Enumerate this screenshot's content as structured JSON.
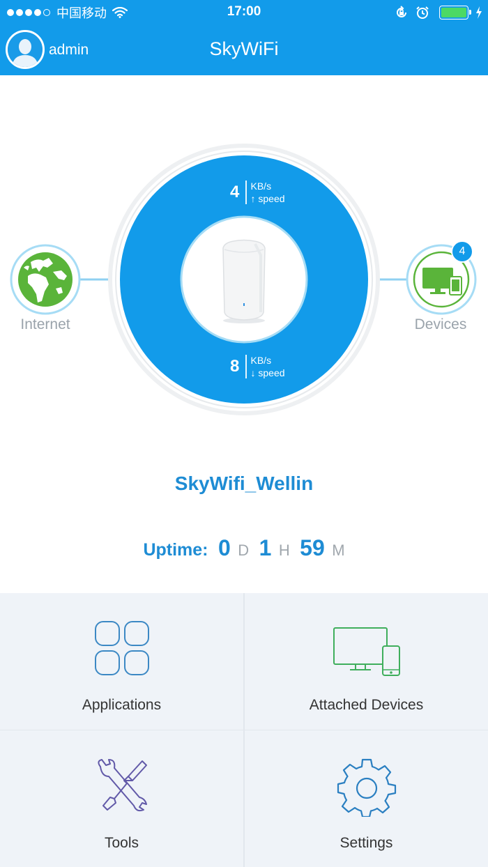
{
  "status_bar": {
    "carrier": "中国移动",
    "time": "17:00"
  },
  "header": {
    "username": "admin",
    "title": "SkyWiFi"
  },
  "network": {
    "internet_label": "Internet",
    "devices_label": "Devices",
    "devices_count": "4",
    "upload": {
      "value": "4",
      "unit": "KB/s",
      "direction": "↑ speed"
    },
    "download": {
      "value": "8",
      "unit": "KB/s",
      "direction": "↓ speed"
    }
  },
  "router": {
    "ssid": "SkyWifi_Wellin",
    "uptime_label": "Uptime:",
    "days": "0",
    "days_unit": "D",
    "hours": "1",
    "hours_unit": "H",
    "minutes": "59",
    "minutes_unit": "M"
  },
  "menu": {
    "applications": "Applications",
    "attached_devices": "Attached Devices",
    "tools": "Tools",
    "settings": "Settings"
  },
  "colors": {
    "brand_blue": "#129bea",
    "text_blue": "#1e8cd4",
    "green": "#5ab43a",
    "grid_bg": "#eff3f8"
  }
}
